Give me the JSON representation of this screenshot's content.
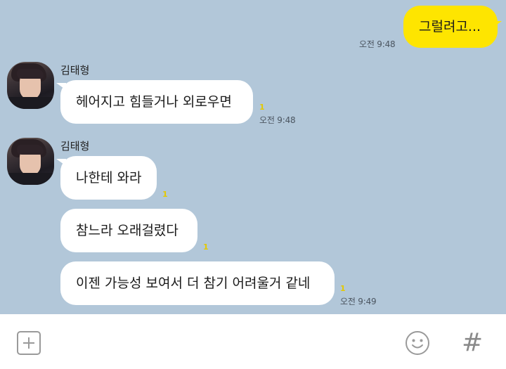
{
  "messages": {
    "out1": {
      "text": "그럴려고...",
      "time": "오전 9:48"
    },
    "group1": {
      "sender": "김태형",
      "text": "헤어지고 힘들거나 외로우면",
      "unread": "1",
      "time": "오전 9:48"
    },
    "group2": {
      "sender": "김태형",
      "items": [
        {
          "text": "나한테 와라",
          "unread": "1"
        },
        {
          "text": "참느라 오래걸렸다",
          "unread": "1"
        },
        {
          "text": "이젠 가능성 보여서 더 참기 어려울거 같네",
          "unread": "1"
        }
      ],
      "time": "오전 9:49"
    }
  },
  "input_bar": {
    "plus_icon": "plus-square-icon",
    "emoji_icon": "smiley-icon",
    "hash_label": "#"
  },
  "colors": {
    "chat_background": "#b2c7d9",
    "outgoing_bubble": "#fee500",
    "incoming_bubble": "#ffffff",
    "unread_count": "#e4c800"
  }
}
